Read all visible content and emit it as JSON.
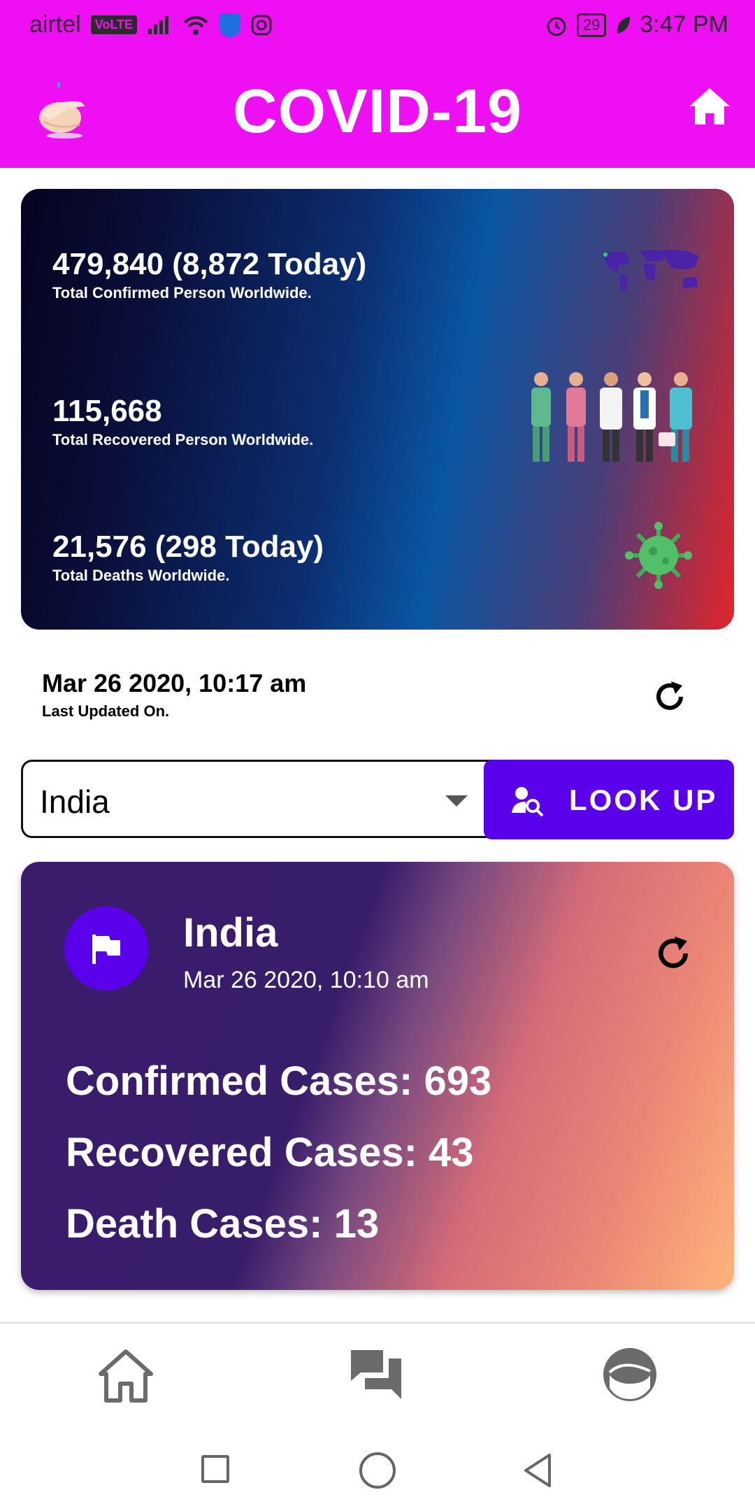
{
  "status_bar": {
    "carrier": "airtel",
    "volte": "VoLTE",
    "battery": "29",
    "time": "3:47 PM"
  },
  "app_bar": {
    "title": "COVID-19",
    "background": "#ee0ff2"
  },
  "world": {
    "confirmed": "479,840 (8,872 Today)",
    "confirmed_label": "Total Confirmed Person Worldwide.",
    "recovered": "115,668",
    "recovered_label": "Total Recovered Person Worldwide.",
    "deaths": "21,576 (298 Today)",
    "deaths_label": "Total Deaths Worldwide."
  },
  "last_updated": {
    "value": "Mar 26 2020, 10:17 am",
    "label": "Last Updated On."
  },
  "country_select": {
    "selected": "India"
  },
  "lookup_button": {
    "label": "LOOK UP",
    "color": "#5b00ea"
  },
  "country_card": {
    "name": "India",
    "date": "Mar 26 2020, 10:10 am",
    "confirmed": "Confirmed Cases: 693",
    "recovered": "Recovered Cases: 43",
    "deaths": "Death Cases: 13"
  },
  "icons": [
    "hand-wash-icon",
    "home-icon",
    "world-map-icon",
    "doctors-illustration-icon",
    "virus-icon",
    "refresh-icon",
    "search-user-icon",
    "flag-icon",
    "chat-icon",
    "avatar-icon"
  ]
}
